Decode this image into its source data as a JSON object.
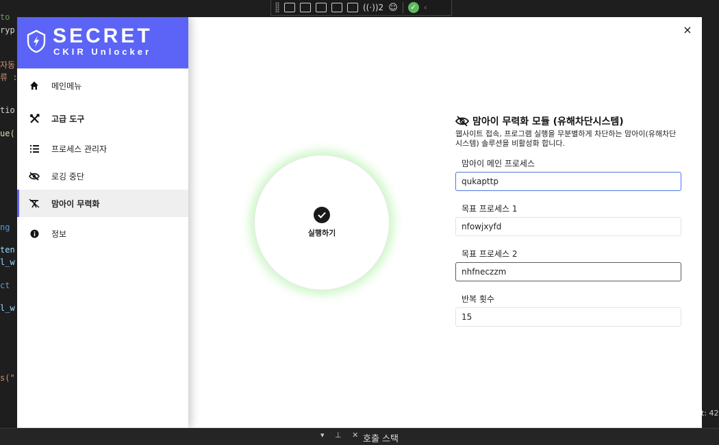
{
  "background": {
    "code_lines": [
      {
        "text": "to",
        "color": "#6a9955"
      },
      {
        "text": "ryp",
        "color": "#d4d4d4"
      },
      {
        "text": "자동",
        "color": "#ce9178"
      },
      {
        "text": "류 :",
        "color": "#ce9178"
      },
      {
        "text": "tio",
        "color": "#d4d4d4"
      },
      {
        "text": "ue(",
        "color": "#dcdcaa"
      },
      {
        "text": "ng",
        "color": "#569cd6"
      },
      {
        "text": "ten",
        "color": "#9cdcfe"
      },
      {
        "text": "l_w",
        "color": "#9cdcfe"
      },
      {
        "text": "ct",
        "color": "#569cd6"
      },
      {
        "text": "l_w",
        "color": "#9cdcfe"
      },
      {
        "text": "s(\"",
        "color": "#ce9178"
      }
    ],
    "devbar_count": "2",
    "bottom_pane_controls": "▾ ⊥ ✕",
    "bottom_tab_title": "호출 스택",
    "side_readout": "t: 42"
  },
  "brand": {
    "title": "SECRET",
    "subtitle": "CKIR Unlocker",
    "color": "#5b64f6"
  },
  "menu": {
    "items": [
      {
        "label": "메인메뉴",
        "icon": "home-icon"
      },
      {
        "label": "고급 도구",
        "icon": "tools-icon"
      },
      {
        "label": "프로세스 관리자",
        "icon": "list-icon"
      },
      {
        "label": "로깅 중단",
        "icon": "eye-slash-icon"
      },
      {
        "label": "맘아이 무력화",
        "icon": "crossed-tools-icon"
      },
      {
        "label": "정보",
        "icon": "info-icon"
      }
    ],
    "active_index": 4
  },
  "window": {
    "close_label": "×"
  },
  "run_button": {
    "label": "실행하기"
  },
  "module": {
    "title": "맘아이 무력화 모듈 (유해차단시스템)",
    "description": "웹사이트 접속, 프로그램 실행을 무분별하게 차단하는 맘아이(유해차단시스템) 솔루션을 비활성화 합니다.",
    "fields": [
      {
        "label": "맘아이 메인 프로세스",
        "value": "qukapttp"
      },
      {
        "label": "목표 프로세스 1",
        "value": "nfowjxyfd"
      },
      {
        "label": "목표 프로세스 2",
        "value": "nhfneczzm"
      },
      {
        "label": "반복 횟수",
        "value": "15"
      }
    ]
  }
}
